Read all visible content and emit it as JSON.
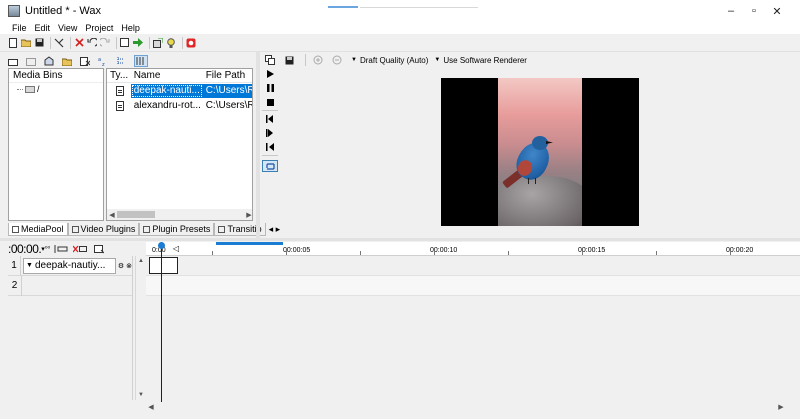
{
  "window": {
    "title": "Untitled * - Wax"
  },
  "menu": [
    "File",
    "Edit",
    "View",
    "Project",
    "Help"
  ],
  "window_controls": {
    "minimize": "–",
    "maximize": "▫",
    "close": "✕"
  },
  "preview_toolbar": {
    "quality_label": "Draft Quality (Auto)",
    "renderer_label": "Use Software Renderer"
  },
  "media_bins": {
    "header": "Media Bins",
    "items": [
      {
        "label": "/"
      }
    ]
  },
  "files": {
    "columns": {
      "type": "Ty...",
      "name": "Name",
      "path": "File Path"
    },
    "rows": [
      {
        "name": "deepak-nauti...",
        "path": "C:\\Users\\R",
        "selected": true
      },
      {
        "name": "alexandru-rot...",
        "path": "C:\\Users\\R",
        "selected": false
      }
    ]
  },
  "panel_tabs": [
    {
      "label": "MediaPool",
      "active": true
    },
    {
      "label": "Video Plugins",
      "active": false
    },
    {
      "label": "Plugin Presets",
      "active": false
    },
    {
      "label": "Transitio",
      "active": false
    }
  ],
  "timeline": {
    "timecode": ":00:00.",
    "ruler_labels": [
      "00:00:05",
      "00:00:10",
      "00:00:15",
      "00:00:20"
    ],
    "ruler_start": "0:00",
    "tracks": [
      {
        "number": "1",
        "name": "deepak-nautiy..."
      },
      {
        "number": "2",
        "name": ""
      }
    ]
  }
}
